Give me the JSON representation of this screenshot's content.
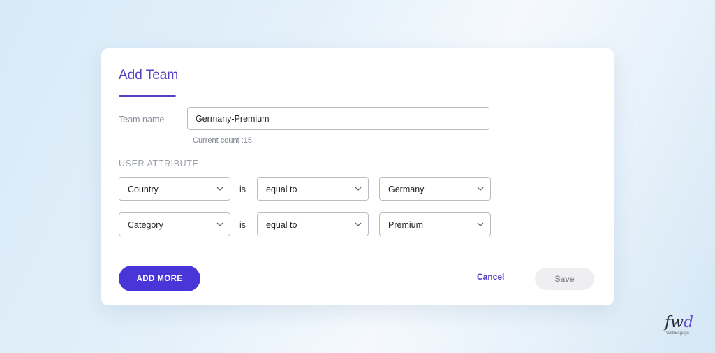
{
  "modal": {
    "title": "Add Team"
  },
  "team": {
    "label": "Team name",
    "value": "Germany-Premium",
    "count_text": "Current count :15"
  },
  "attributes": {
    "section_label": "USER ATTRIBUTE",
    "rows": [
      {
        "attribute": "Country",
        "connector": "is",
        "operator": "equal to",
        "value": "Germany"
      },
      {
        "attribute": "Category",
        "connector": "is",
        "operator": "equal to",
        "value": "Premium"
      }
    ]
  },
  "actions": {
    "add_more": "ADD MORE",
    "cancel": "Cancel",
    "save": "Save"
  },
  "brand": {
    "logo_mark_prefix": "fw",
    "logo_mark_suffix": "d",
    "logo_sub": "WebEngage"
  },
  "colors": {
    "accent": "#5240c6",
    "primary_button": "#4836d9"
  },
  "icons": {
    "dropdown": "chevron-down-icon"
  }
}
